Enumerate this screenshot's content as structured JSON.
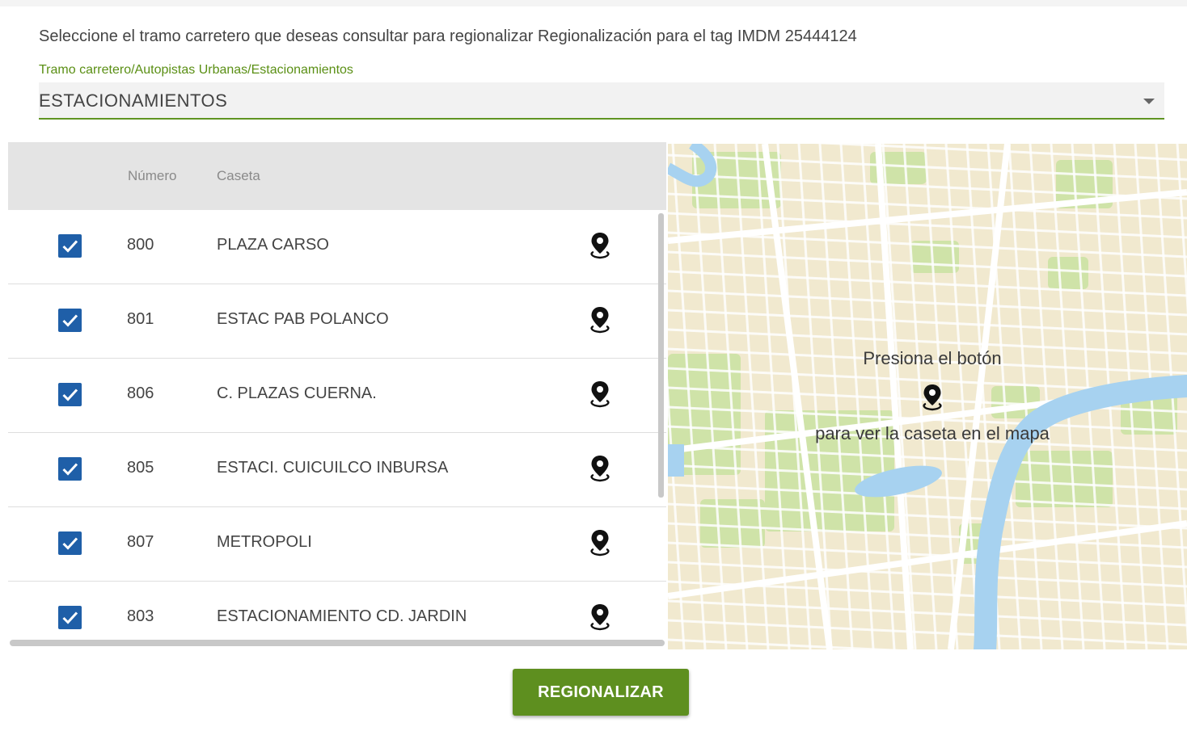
{
  "header": {
    "instruction": "Seleccione el tramo carretero que deseas consultar para regionalizar Regionalización para el tag IMDM 25444124"
  },
  "select": {
    "label": "Tramo carretero/Autopistas Urbanas/Estacionamientos",
    "value": "ESTACIONAMIENTOS"
  },
  "table": {
    "columns": {
      "numero": "Número",
      "caseta": "Caseta"
    },
    "rows": [
      {
        "checked": true,
        "numero": "800",
        "caseta": "PLAZA CARSO"
      },
      {
        "checked": true,
        "numero": "801",
        "caseta": "ESTAC PAB POLANCO"
      },
      {
        "checked": true,
        "numero": "806",
        "caseta": "C. PLAZAS CUERNA."
      },
      {
        "checked": true,
        "numero": "805",
        "caseta": "ESTACI. CUICUILCO INBURSA"
      },
      {
        "checked": true,
        "numero": "807",
        "caseta": "METROPOLI"
      },
      {
        "checked": true,
        "numero": "803",
        "caseta": "ESTACIONAMIENTO CD. JARDIN"
      }
    ]
  },
  "map": {
    "hint_top": "Presiona el botón",
    "hint_bottom": "para ver la caseta en el mapa"
  },
  "actions": {
    "regionalizar_label": "REGIONALIZAR"
  },
  "colors": {
    "accent_green": "#5e8f1f",
    "checkbox_blue": "#1f5fa8",
    "map_water": "#a7d2f0",
    "map_park": "#cfe3a8",
    "map_land": "#f1e9cf"
  },
  "icons": {
    "row_action": "map-pin-icon",
    "select_caret": "caret-down-icon",
    "checkbox": "check-icon"
  }
}
